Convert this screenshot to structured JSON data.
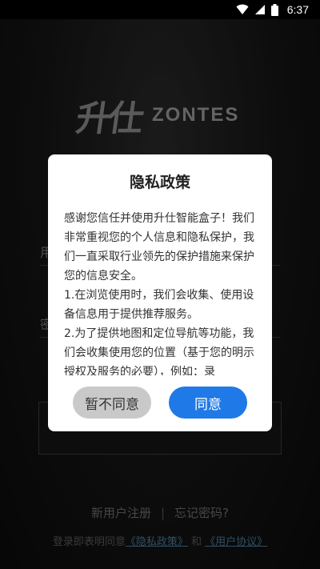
{
  "status_bar": {
    "time": "6:37"
  },
  "background": {
    "logo_text": "ZONTES",
    "username_prefix": "用",
    "password_prefix": "密",
    "footer": {
      "register_label": "新用户注册",
      "divider": "|",
      "forgot_label": "忘记密码?"
    },
    "agreement": {
      "prefix": "登录即表明同意",
      "privacy_link": "《隐私政策》",
      "and": "和",
      "user_agreement_link": "《用户协议》"
    }
  },
  "dialog": {
    "title": "隐私政策",
    "paragraphs": [
      "感谢您信任并使用升仕智能盒子！我们非常重视您的个人信息和隐私保护，我们一直采取行业领先的保护措施来保护您的信息安全。",
      "1.在浏览使用时，我们会收集、使用设备信息用于提供推荐服务。",
      "2.为了提供地图和定位导航等功能，我们会收集使用您的位置（基于您的明示授权及服务的必要），例如：录"
    ],
    "decline_label": "暂不同意",
    "agree_label": "同意"
  },
  "colors": {
    "agree_button": "#1f7ae8",
    "decline_button": "#c9c9c9"
  }
}
